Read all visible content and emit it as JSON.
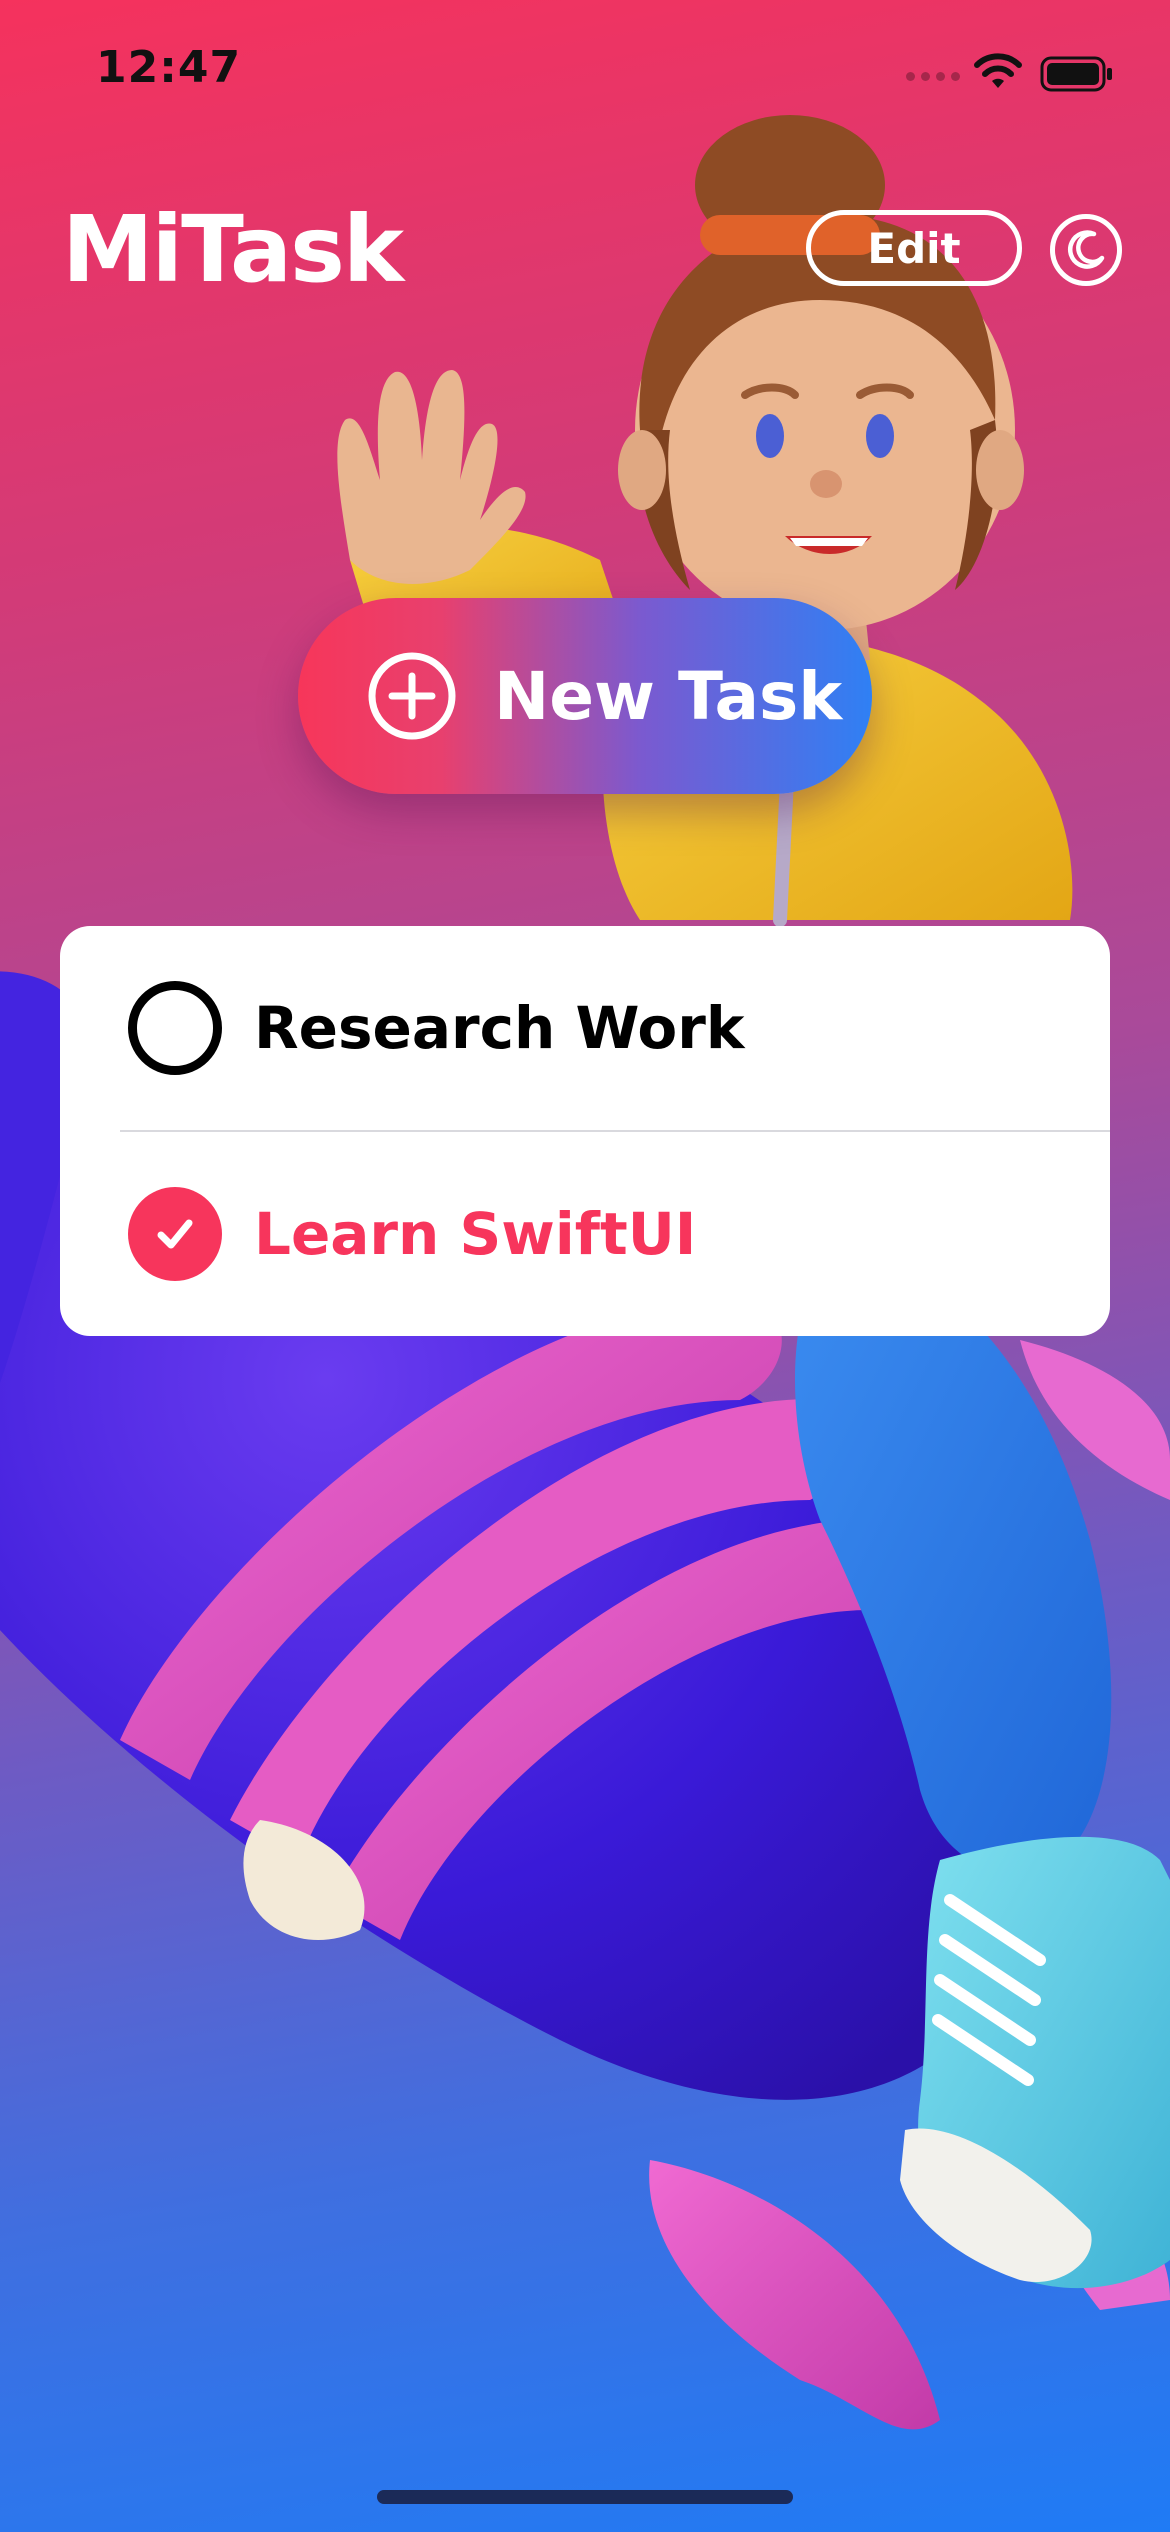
{
  "status_bar": {
    "time": "12:47",
    "icons": [
      "signal-icon",
      "wifi-icon",
      "battery-icon"
    ]
  },
  "header": {
    "title": "MiTask",
    "edit_label": "Edit",
    "theme_icon": "moon-icon"
  },
  "new_task": {
    "label": "New Task",
    "icon": "plus-circle-icon"
  },
  "tasks": [
    {
      "title": "Research Work",
      "completed": false
    },
    {
      "title": "Learn SwiftUI",
      "completed": true
    }
  ],
  "colors": {
    "accent": "#f7355c",
    "blue": "#2f80f4",
    "background_top": "#f5325d",
    "background_bottom": "#1f7bf5"
  }
}
